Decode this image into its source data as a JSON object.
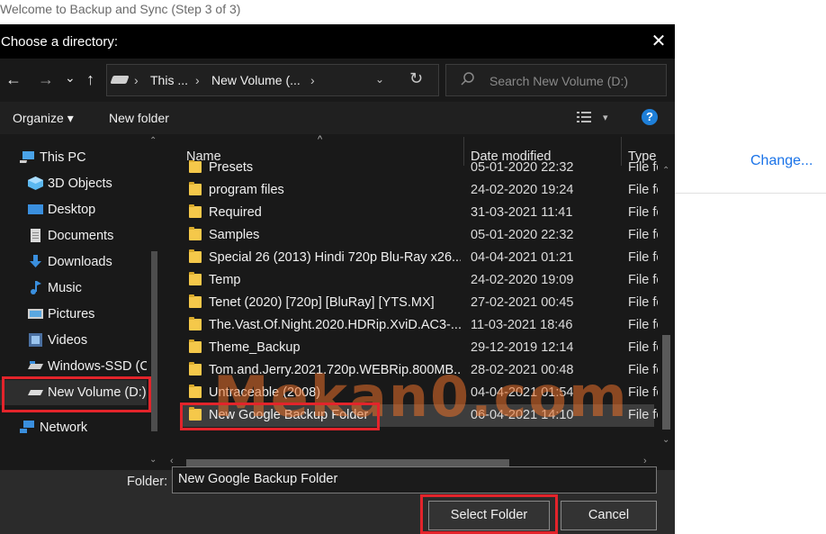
{
  "background_window": {
    "title": "Welcome to Backup and Sync (Step 3 of 3)",
    "change_link": "Change..."
  },
  "dialog": {
    "title": "Choose a directory:",
    "close_glyph": "✕"
  },
  "navigation": {
    "back_glyph": "←",
    "forward_glyph": "→",
    "recent_glyph": "⌄",
    "up_glyph": "↑",
    "breadcrumbs": [
      "This ...",
      "New Volume (..."
    ],
    "breadcrumb_sep": "›",
    "dropdown_glyph": "⌄",
    "refresh_glyph": "↻",
    "search_placeholder": "Search New Volume (D:)"
  },
  "toolbar": {
    "organize": "Organize ▾",
    "new_folder": "New folder",
    "view_dropdown": "▾",
    "help": "?"
  },
  "sidebar": {
    "items": [
      {
        "label": "This PC",
        "icon": "computer-icon"
      },
      {
        "label": "3D Objects",
        "icon": "3d-objects-icon"
      },
      {
        "label": "Desktop",
        "icon": "desktop-icon"
      },
      {
        "label": "Documents",
        "icon": "documents-icon"
      },
      {
        "label": "Downloads",
        "icon": "downloads-icon"
      },
      {
        "label": "Music",
        "icon": "music-icon"
      },
      {
        "label": "Pictures",
        "icon": "pictures-icon"
      },
      {
        "label": "Videos",
        "icon": "videos-icon"
      },
      {
        "label": "Windows-SSD (C",
        "icon": "drive-icon"
      },
      {
        "label": "New Volume (D:)",
        "icon": "drive-icon"
      },
      {
        "label": "Network",
        "icon": "network-icon"
      }
    ]
  },
  "filelist": {
    "columns": [
      "Name",
      "Date modified",
      "Type"
    ],
    "sort_caret": "^",
    "rows": [
      {
        "name": "Presets",
        "date": "05-01-2020 22:32",
        "type": "File fo"
      },
      {
        "name": "program files",
        "date": "24-02-2020 19:24",
        "type": "File fo"
      },
      {
        "name": "Required",
        "date": "31-03-2021 11:41",
        "type": "File fo"
      },
      {
        "name": "Samples",
        "date": "05-01-2020 22:32",
        "type": "File fo"
      },
      {
        "name": "Special 26 (2013) Hindi 720p Blu-Ray x26...",
        "date": "04-04-2021 01:21",
        "type": "File fo"
      },
      {
        "name": "Temp",
        "date": "24-02-2020 19:09",
        "type": "File fo"
      },
      {
        "name": "Tenet (2020) [720p] [BluRay] [YTS.MX]",
        "date": "27-02-2021 00:45",
        "type": "File fo"
      },
      {
        "name": "The.Vast.Of.Night.2020.HDRip.XviD.AC3-...",
        "date": "11-03-2021 18:46",
        "type": "File fo"
      },
      {
        "name": "Theme_Backup",
        "date": "29-12-2019 12:14",
        "type": "File fo"
      },
      {
        "name": "Tom.and.Jerry.2021.720p.WEBRip.800MB....",
        "date": "28-02-2021 00:48",
        "type": "File fo"
      },
      {
        "name": "Untraceable (2008)",
        "date": "04-04-2021 01:54",
        "type": "File fo"
      },
      {
        "name": "New Google Backup Folder",
        "date": "06-04-2021 14:10",
        "type": "File fo"
      }
    ]
  },
  "footer": {
    "folder_label": "Folder:",
    "folder_value": "New Google Backup Folder",
    "select_button": "Select Folder",
    "cancel_button": "Cancel"
  },
  "watermark": "Mekan0.com",
  "colors": {
    "highlight": "#e3242b",
    "folder": "#f5c84a",
    "link": "#1a73e8"
  }
}
